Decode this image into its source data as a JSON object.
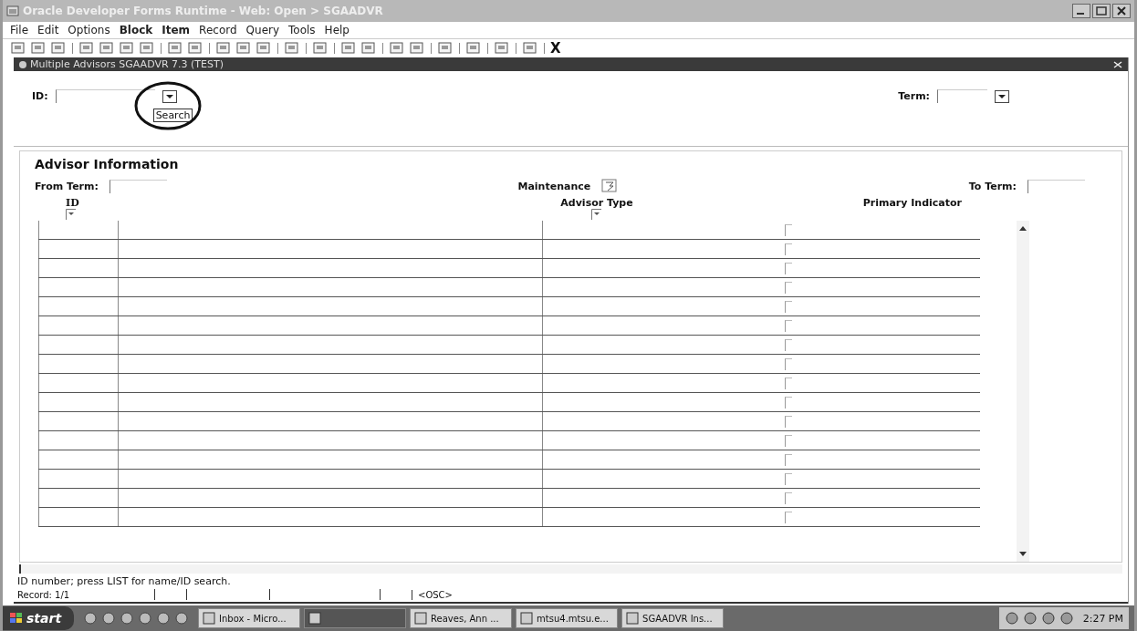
{
  "window": {
    "title": "Oracle Developer Forms Runtime - Web: Open > SGAADVR"
  },
  "menu": [
    {
      "label": "File",
      "bold": false
    },
    {
      "label": "Edit",
      "bold": false
    },
    {
      "label": "Options",
      "bold": false
    },
    {
      "label": "Block",
      "bold": true
    },
    {
      "label": "Item",
      "bold": true
    },
    {
      "label": "Record",
      "bold": false
    },
    {
      "label": "Query",
      "bold": false
    },
    {
      "label": "Tools",
      "bold": false
    },
    {
      "label": "Help",
      "bold": false
    }
  ],
  "toolbar": {
    "exit_glyph": "X"
  },
  "form": {
    "title": "Multiple Advisors  SGAADVR  7.3  (TEST)",
    "key": {
      "id_label": "ID:",
      "tooltip": "Search",
      "term_label": "Term:"
    },
    "block_title": "Advisor Information",
    "from_term_label": "From Term:",
    "maintenance_label": "Maintenance",
    "to_term_label": "To Term:",
    "columns": [
      "ID",
      "Advisor Type",
      "Primary Indicator"
    ],
    "rows": [
      {
        "primary": false
      },
      {
        "primary": false
      },
      {
        "primary": false
      },
      {
        "primary": false
      },
      {
        "primary": false
      },
      {
        "primary": false
      },
      {
        "primary": false
      },
      {
        "primary": false
      },
      {
        "primary": false
      },
      {
        "primary": false
      },
      {
        "primary": false
      },
      {
        "primary": false
      },
      {
        "primary": false
      },
      {
        "primary": false
      },
      {
        "primary": false
      },
      {
        "primary": false
      }
    ]
  },
  "status_bar": {
    "hint": "ID number; press LIST for name/ID search.",
    "record": "Record: 1/1",
    "mode": "<OSC>"
  },
  "taskbar": {
    "start": "start",
    "tasks": [
      {
        "label": "Inbox - Micro...",
        "selected": false
      },
      {
        "selected": true
      },
      {
        "label": "Reaves, Ann ...",
        "selected": false
      },
      {
        "label": "mtsu4.mtsu.e...",
        "selected": false
      },
      {
        "label": "SGAADVR Ins...",
        "selected": false
      }
    ],
    "clock": "2:27 PM"
  }
}
